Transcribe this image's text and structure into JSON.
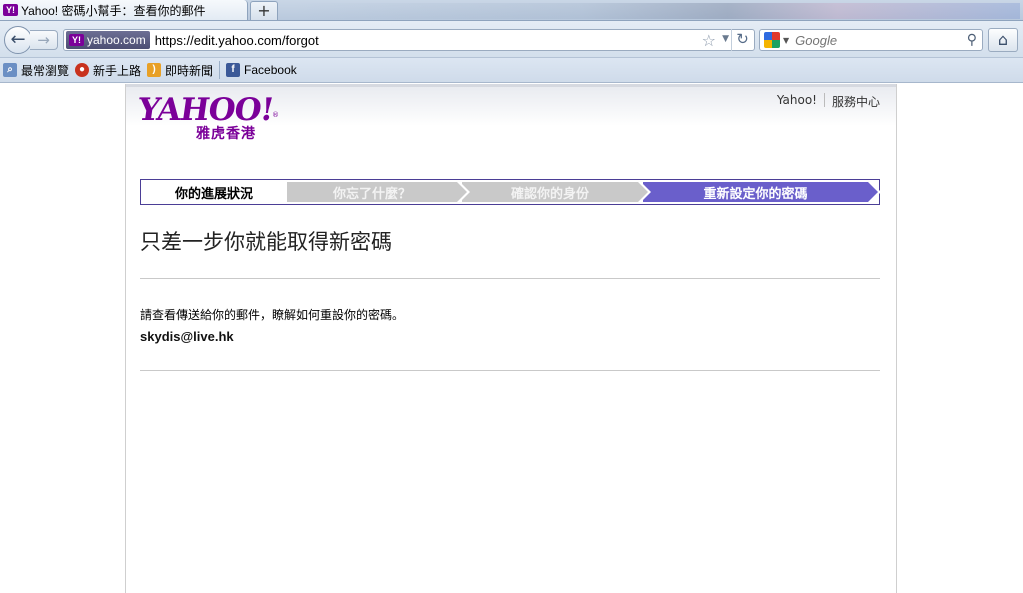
{
  "browser": {
    "tab_title": "Yahoo! 密碼小幫手：查看你的郵件",
    "new_tab_label": "+",
    "site_identity": "yahoo.com",
    "url": "https://edit.yahoo.com/forgot",
    "search_placeholder": "Google",
    "icons": {
      "back": "back-arrow-icon",
      "forward": "forward-arrow-icon",
      "reload": "reload-icon",
      "bookmark_star": "star-icon",
      "search": "magnifier-icon",
      "home": "home-icon"
    }
  },
  "bookmarks": [
    {
      "label": "最常瀏覽",
      "icon": "search-page-icon"
    },
    {
      "label": "新手上路",
      "icon": "firefox-icon"
    },
    {
      "label": "即時新聞",
      "icon": "rss-icon"
    },
    {
      "label": "Facebook",
      "icon": "facebook-icon"
    }
  ],
  "header": {
    "logo_text": "YAHOO!",
    "logo_sub": "雅虎香港",
    "logo_reg": "®",
    "links": [
      "Yahoo!",
      "服務中心"
    ]
  },
  "progress": {
    "label": "你的進展狀況",
    "steps": [
      {
        "label": "你忘了什麼？",
        "state": "done"
      },
      {
        "label": "確認你的身份",
        "state": "done"
      },
      {
        "label": "重新設定你的密碼",
        "state": "current"
      }
    ]
  },
  "main": {
    "heading": "只差一步你就能取得新密碼",
    "instruction": "請查看傳送給你的郵件，瞭解如何重設你的密碼。",
    "email": "skydis@live.hk"
  },
  "colors": {
    "brand_purple": "#7b0099",
    "step_current": "#6a5fcb",
    "step_done": "#c9c9c9",
    "progress_border": "#4b3e96"
  }
}
